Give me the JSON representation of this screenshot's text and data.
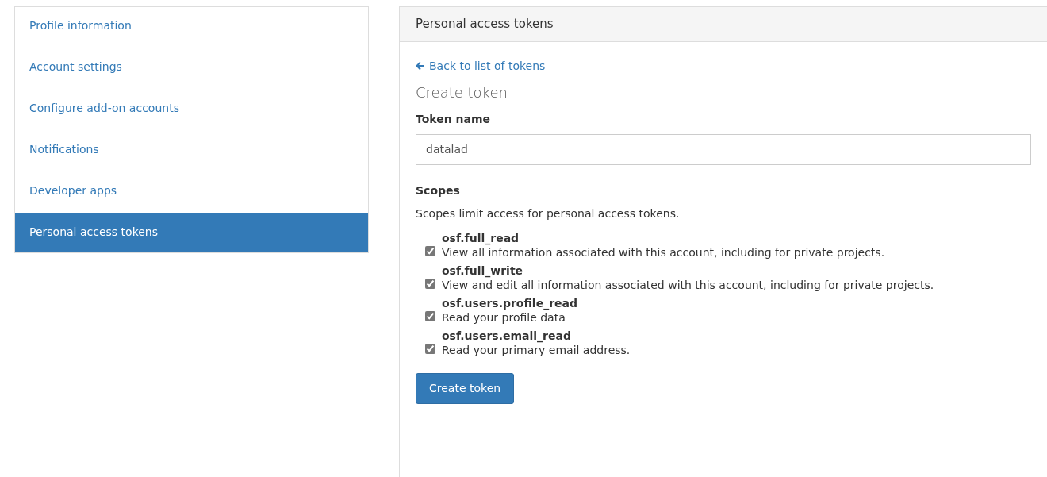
{
  "sidebar": {
    "items": [
      {
        "label": "Profile information",
        "selected": false
      },
      {
        "label": "Account settings",
        "selected": false
      },
      {
        "label": "Configure add-on accounts",
        "selected": false
      },
      {
        "label": "Notifications",
        "selected": false
      },
      {
        "label": "Developer apps",
        "selected": false
      },
      {
        "label": "Personal access tokens",
        "selected": true
      }
    ]
  },
  "panel": {
    "title": "Personal access tokens",
    "back_link": "Back to list of tokens",
    "heading": "Create token",
    "token_name": {
      "label": "Token name",
      "value": "datalad"
    },
    "scopes": {
      "label": "Scopes",
      "help": "Scopes limit access for personal access tokens.",
      "items": [
        {
          "name": "osf.full_read",
          "description": "View all information associated with this account, including for private projects.",
          "checked": true
        },
        {
          "name": "osf.full_write",
          "description": "View and edit all information associated with this account, including for private projects.",
          "checked": true
        },
        {
          "name": "osf.users.profile_read",
          "description": "Read your profile data",
          "checked": true
        },
        {
          "name": "osf.users.email_read",
          "description": "Read your primary email address.",
          "checked": true
        }
      ]
    },
    "submit": "Create token"
  }
}
